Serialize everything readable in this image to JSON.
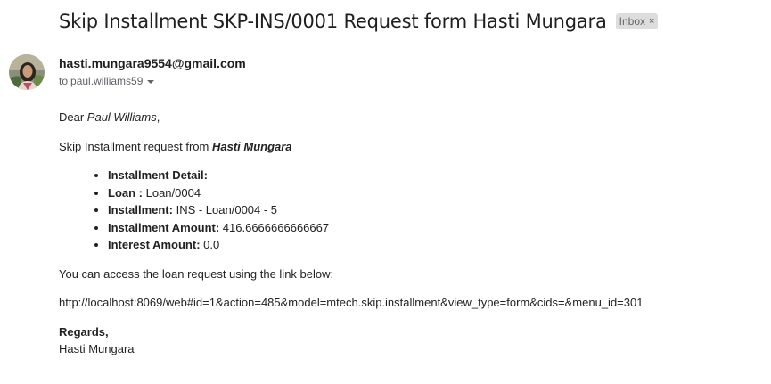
{
  "email": {
    "subject": "Skip Installment SKP-INS/0001 Request form Hasti Mungara",
    "label": "Inbox",
    "label_close": "×",
    "sender_email": "hasti.mungara9554@gmail.com",
    "to_prefix": "to",
    "recipient": "paul.williams59"
  },
  "body": {
    "greeting_prefix": "Dear ",
    "greeting_name": "Paul Williams",
    "greeting_suffix": ",",
    "intro_prefix": "Skip Installment request from ",
    "intro_name": "Hasti Mungara",
    "details": [
      {
        "label": "Installment Detail:",
        "value": ""
      },
      {
        "label": "Loan :",
        "value": " Loan/0004"
      },
      {
        "label": "Installment:",
        "value": " INS - Loan/0004 - 5"
      },
      {
        "label": "Installment Amount:",
        "value": " 416.6666666666667"
      },
      {
        "label": "Interest Amount:",
        "value": " 0.0"
      }
    ],
    "access_text": "You can access the loan request using the link below:",
    "link": "http://localhost:8069/web#id=1&action=485&model=mtech.skip.installment&view_type=form&cids=&menu_id=301",
    "regards": "Regards,",
    "signature": "Hasti Mungara"
  },
  "colors": {
    "label_chip_bg": "#dddddd",
    "text": "#222222",
    "muted": "#5f6368"
  }
}
